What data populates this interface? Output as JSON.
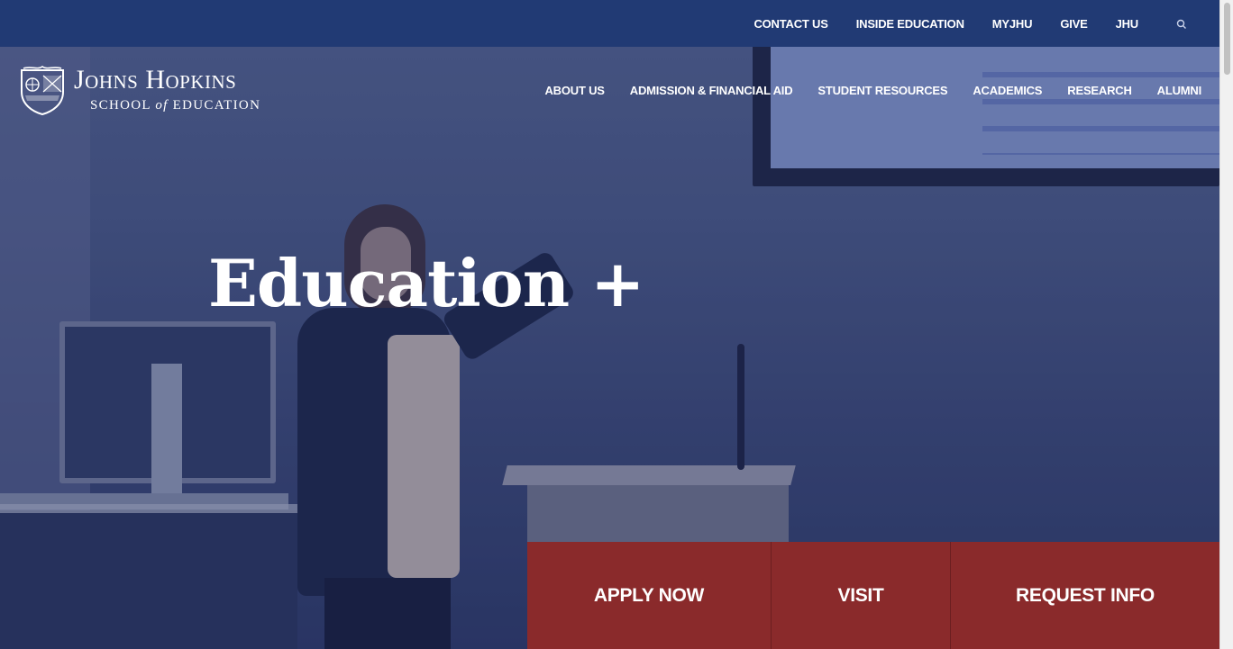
{
  "utility_nav": {
    "items": [
      "CONTACT US",
      "INSIDE EDUCATION",
      "MYJHU",
      "GIVE",
      "JHU"
    ],
    "search_icon": "search-icon"
  },
  "logo": {
    "title": "Johns Hopkins",
    "subtitle_pre": "SCHOOL",
    "subtitle_of": "of",
    "subtitle_post": "EDUCATION"
  },
  "main_nav": {
    "items": [
      "ABOUT US",
      "ADMISSION & FINANCIAL AID",
      "STUDENT RESOURCES",
      "ACADEMICS",
      "RESEARCH",
      "ALUMNI"
    ]
  },
  "hero": {
    "title": "Education +"
  },
  "cta": {
    "apply": "APPLY NOW",
    "visit": "VISIT",
    "request": "REQUEST INFO"
  },
  "colors": {
    "utility_bar": "#213a74",
    "cta_red": "#8a2a2b",
    "text_white": "#ffffff"
  }
}
